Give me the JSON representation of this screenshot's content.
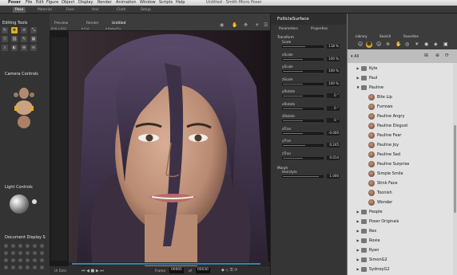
{
  "menubar": {
    "app_name": "Poser",
    "menus": [
      "File",
      "Edit",
      "Figure",
      "Object",
      "Display",
      "Render",
      "Animation",
      "Window",
      "Scripts",
      "Help"
    ],
    "window_title": "Untitled - Smith Micro Poser"
  },
  "room_tabs": [
    {
      "label": "Pose",
      "active": true
    },
    {
      "label": "Material",
      "active": false
    },
    {
      "label": "Face",
      "active": false
    },
    {
      "label": "Hair",
      "active": false
    },
    {
      "label": "Cloth",
      "active": false
    },
    {
      "label": "Setup",
      "active": false
    }
  ],
  "left_panel": {
    "editing_tools_title": "Editing Tools",
    "camera_controls_title": "Camera Controls",
    "light_controls_title": "Light Controls",
    "document_display_title": "Document Display S"
  },
  "viewport": {
    "tabs": [
      "Preview",
      "Render",
      "Untitled"
    ],
    "size_label": "836 x 652",
    "figure_select": "Full",
    "camera_select": "Body/Fly",
    "footer_label": "UI Dots",
    "frame_label": "Frame",
    "frame_value": "00001",
    "frame_of": "of",
    "frame_total": "00030"
  },
  "parameters_panel": {
    "title": "FollicleSurface",
    "tabs": [
      "Parameters",
      "Properties"
    ],
    "group_label": "Transform",
    "params": [
      {
        "label": "Scale",
        "value": "118 %",
        "fill": 0.55
      },
      {
        "label": "xScale",
        "value": "100 %",
        "fill": 0.5
      },
      {
        "label": "yScale",
        "value": "100 %",
        "fill": 0.5
      },
      {
        "label": "zScale",
        "value": "100 %",
        "fill": 0.5
      },
      {
        "label": "yRotate",
        "value": "0 °",
        "fill": 0.5
      },
      {
        "label": "xRotate",
        "value": "0 °",
        "fill": 0.5
      },
      {
        "label": "zRotate",
        "value": "0 °",
        "fill": 0.5
      },
      {
        "label": "xTran",
        "value": "-0.000",
        "fill": 0.5
      },
      {
        "label": "yTran",
        "value": "0.245",
        "fill": 0.55
      },
      {
        "label": "zTran",
        "value": "0.014",
        "fill": 0.5
      }
    ],
    "morph_label": "Morph",
    "morph_param": {
      "label": "Hairstyle",
      "value": "1.000",
      "fill": 0.9
    }
  },
  "library": {
    "tabs": [
      "Library",
      "Search",
      "Favorites"
    ],
    "root_label": "All",
    "items": [
      {
        "label": "Kyle",
        "kind": "folder",
        "level": 1,
        "expanded": false
      },
      {
        "label": "Paul",
        "kind": "folder",
        "level": 1,
        "expanded": false
      },
      {
        "label": "Pauline",
        "kind": "folder",
        "level": 1,
        "expanded": true
      },
      {
        "label": "Bite Lip",
        "kind": "pose",
        "level": 2
      },
      {
        "label": "Furrows",
        "kind": "pose",
        "level": 2
      },
      {
        "label": "Pauline Angry",
        "kind": "pose",
        "level": 2
      },
      {
        "label": "Pauline Disgust",
        "kind": "pose",
        "level": 2
      },
      {
        "label": "Pauline Fear",
        "kind": "pose",
        "level": 2
      },
      {
        "label": "Pauline Joy",
        "kind": "pose",
        "level": 2
      },
      {
        "label": "Pauline Sad",
        "kind": "pose",
        "level": 2
      },
      {
        "label": "Pauline Surprise",
        "kind": "pose",
        "level": 2
      },
      {
        "label": "Simple Smile",
        "kind": "pose",
        "level": 2
      },
      {
        "label": "Stink Face",
        "kind": "pose",
        "level": 2
      },
      {
        "label": "Toonish",
        "kind": "pose",
        "level": 2
      },
      {
        "label": "Wonder",
        "kind": "pose",
        "level": 2
      },
      {
        "label": "People",
        "kind": "folder",
        "level": 1,
        "expanded": false
      },
      {
        "label": "Poser Originals",
        "kind": "folder",
        "level": 1,
        "expanded": false
      },
      {
        "label": "Rex",
        "kind": "folder",
        "level": 1,
        "expanded": false
      },
      {
        "label": "Roxie",
        "kind": "folder",
        "level": 1,
        "expanded": false
      },
      {
        "label": "Ryan",
        "kind": "folder",
        "level": 1,
        "expanded": false
      },
      {
        "label": "SimonG2",
        "kind": "folder",
        "level": 1,
        "expanded": false
      },
      {
        "label": "SydneyG2",
        "kind": "folder",
        "level": 1,
        "expanded": false
      }
    ]
  },
  "colors": {
    "accent": "#e0b020",
    "background": "#2b2b2b",
    "library_bg": "#e2e2e2"
  }
}
